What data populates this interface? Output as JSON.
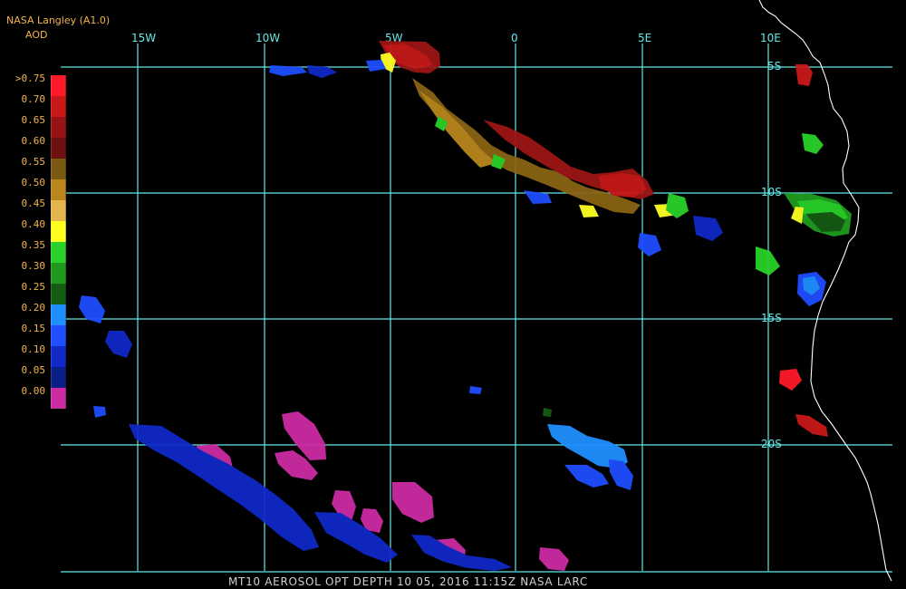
{
  "header": {
    "source_label": "NASA Langley (A1.0)",
    "product_label": "AOD"
  },
  "legend": {
    "items": [
      {
        "label": ">0.75",
        "color": "#ff1a2a"
      },
      {
        "label": "0.70",
        "color": "#c81818"
      },
      {
        "label": "0.65",
        "color": "#981414"
      },
      {
        "label": "0.60",
        "color": "#6c1010"
      },
      {
        "label": "0.55",
        "color": "#7a5a12"
      },
      {
        "label": "0.50",
        "color": "#b8861d"
      },
      {
        "label": "0.45",
        "color": "#e4b44f"
      },
      {
        "label": "0.40",
        "color": "#ffff22"
      },
      {
        "label": "0.35",
        "color": "#2ad12a"
      },
      {
        "label": "0.30",
        "color": "#1f9a1f"
      },
      {
        "label": "0.25",
        "color": "#145b14"
      },
      {
        "label": "0.20",
        "color": "#1f8fff"
      },
      {
        "label": "0.15",
        "color": "#1f4dff"
      },
      {
        "label": "0.10",
        "color": "#1029c7"
      },
      {
        "label": "0.05",
        "color": "#0a1f86"
      },
      {
        "label": "0.00",
        "color": "#cc2ca3"
      }
    ]
  },
  "map": {
    "lon_labels": [
      "15W",
      "10W",
      "5W",
      "0",
      "5E",
      "10E"
    ],
    "lat_labels": [
      "5S",
      "10S",
      "15S",
      "20S"
    ],
    "grid_color": "#64e8e8",
    "coastline_color": "#ffffff"
  },
  "footer": {
    "title": "MT10  AEROSOL OPT DEPTH   10 05, 2016 11:15Z   NASA LARC"
  }
}
